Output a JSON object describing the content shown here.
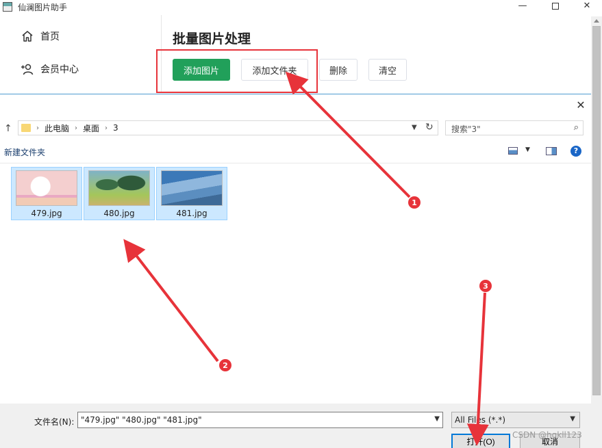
{
  "window": {
    "title": "仙澜图片助手",
    "minimize": "—",
    "close": "✕"
  },
  "sidebar": {
    "items": [
      {
        "label": "首页",
        "icon": "home-icon"
      },
      {
        "label": "会员中心",
        "icon": "add-user-icon"
      }
    ]
  },
  "main": {
    "title": "批量图片处理",
    "buttons": {
      "add_image": "添加图片",
      "add_folder": "添加文件夹",
      "delete": "删除",
      "clear": "清空"
    },
    "primary_color": "#21a05a"
  },
  "dialog": {
    "close": "✕",
    "breadcrumb": [
      "此电脑",
      "桌面",
      "3"
    ],
    "search_placeholder": "搜索\"3\"",
    "new_folder": "新建文件夹",
    "help": "?",
    "files": [
      {
        "name": "479.jpg",
        "selected": true
      },
      {
        "name": "480.jpg",
        "selected": true
      },
      {
        "name": "481.jpg",
        "selected": true
      }
    ],
    "filename_label": "文件名(N):",
    "filename_value": "\"479.jpg\" \"480.jpg\" \"481.jpg\"",
    "filter_value": "All Files (*.*)",
    "open_button": "打开(O)",
    "cancel_button": "取消"
  },
  "annotations": {
    "markers": [
      "1",
      "2",
      "3"
    ],
    "color": "#e7333a"
  },
  "watermark": "CSDN @hqkll123"
}
